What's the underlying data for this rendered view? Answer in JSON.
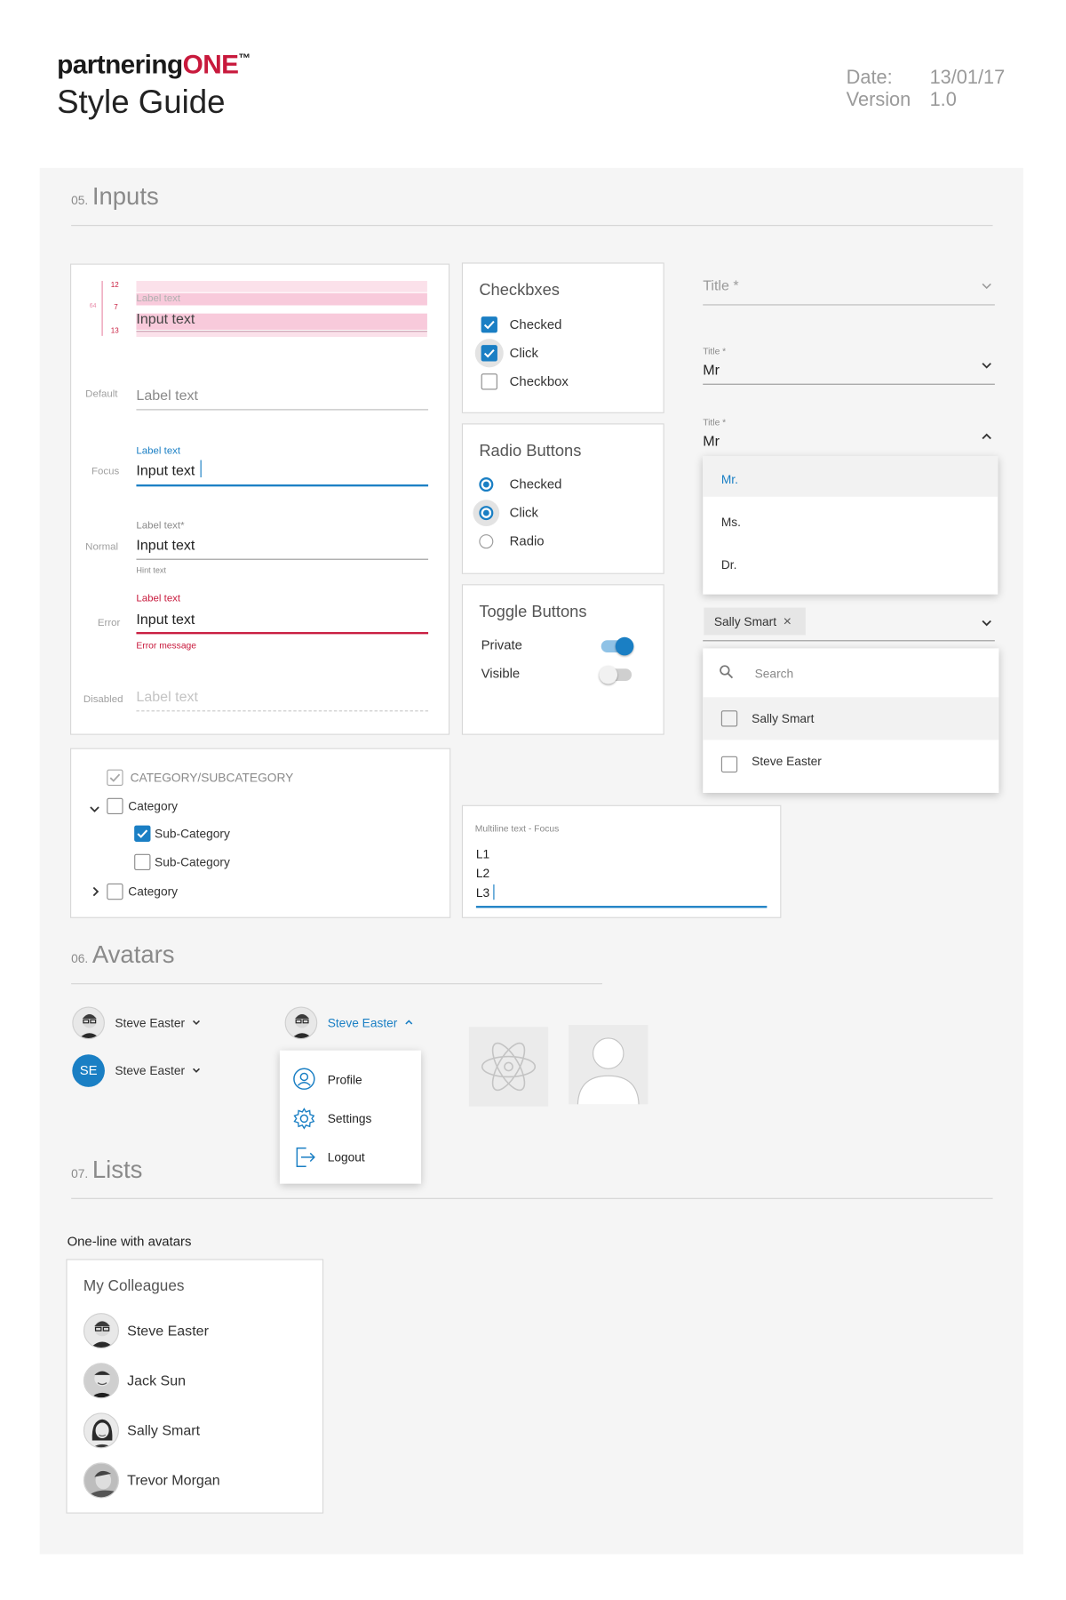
{
  "header": {
    "brand_prefix": "partnering",
    "brand_suffix": "ONE",
    "brand_tm": "™",
    "subtitle": "Style Guide",
    "date_label": "Date:",
    "date_value": "13/01/17",
    "version_label": "Version",
    "version_value": "1.0"
  },
  "inputs": {
    "num": "05.",
    "title": "Inputs",
    "spec": {
      "m12": "12",
      "m7": "7",
      "m64": "64",
      "m13": "13",
      "label": "Label text",
      "input": "Input text"
    },
    "states": [
      {
        "state": "Default",
        "label": "Label text"
      },
      {
        "state": "Focus",
        "label": "Label text",
        "value": "Input text"
      },
      {
        "state": "Normal",
        "label": "Label text*",
        "value": "Input text",
        "hint": "Hint text"
      },
      {
        "state": "Error",
        "label": "Label text",
        "value": "Input text",
        "message": "Error message"
      },
      {
        "state": "Disabled",
        "label": "Label text"
      }
    ],
    "checkboxes": {
      "title": "Checkbxes",
      "items": [
        {
          "label": "Checked",
          "checked": true
        },
        {
          "label": "Click",
          "checked": true
        },
        {
          "label": "Checkbox",
          "checked": false
        }
      ]
    },
    "radios": {
      "title": "Radio Buttons",
      "items": [
        {
          "label": "Checked",
          "selected": true
        },
        {
          "label": "Click",
          "selected": true
        },
        {
          "label": "Radio",
          "selected": false
        }
      ]
    },
    "toggles": {
      "title": "Toggle Buttons",
      "items": [
        {
          "label": "Private",
          "on": true
        },
        {
          "label": "Visible",
          "on": false
        }
      ]
    },
    "selects": {
      "empty_label": "Title *",
      "filled_label": "Title *",
      "filled_value": "Mr",
      "open_label": "Title *",
      "open_value": "Mr",
      "options": [
        "Mr.",
        "Ms.",
        "Dr."
      ]
    },
    "multiselect": {
      "chip": "Sally Smart",
      "chip_close": "×",
      "search_placeholder": "Search",
      "options": [
        {
          "label": "Sally Smart",
          "checked": false
        },
        {
          "label": "Steve Easter",
          "checked": false
        }
      ]
    },
    "tree": {
      "header": "CATEGORY/SUBCATEGORY",
      "items": [
        {
          "label": "Category",
          "expander": "open"
        },
        {
          "label": "Sub-Category",
          "checked": true
        },
        {
          "label": "Sub-Category",
          "checked": false
        },
        {
          "label": "Category",
          "expander": "closed"
        }
      ]
    },
    "multiline": {
      "label": "Multiline text - Focus",
      "lines": [
        "L1",
        "L2",
        "L3"
      ]
    }
  },
  "avatars": {
    "num": "06.",
    "title": "Avatars",
    "user1": "Steve Easter",
    "user2": "Steve Easter",
    "user2_initials": "SE",
    "user_open": "Steve Easter",
    "menu": [
      {
        "label": "Profile",
        "icon": "profile-icon"
      },
      {
        "label": "Settings",
        "icon": "settings-icon"
      },
      {
        "label": "Logout",
        "icon": "logout-icon"
      }
    ]
  },
  "lists": {
    "num": "07.",
    "title": "Lists",
    "subtitle": "One-line with avatars",
    "card_title": "My Colleagues",
    "people": [
      "Steve Easter",
      "Jack Sun",
      "Sally Smart",
      "Trevor Morgan"
    ]
  },
  "colors": {
    "accent": "#1a7fc4",
    "brand_red": "#c8193c",
    "error": "#c8193c",
    "panel_bg": "#f5f5f5"
  }
}
